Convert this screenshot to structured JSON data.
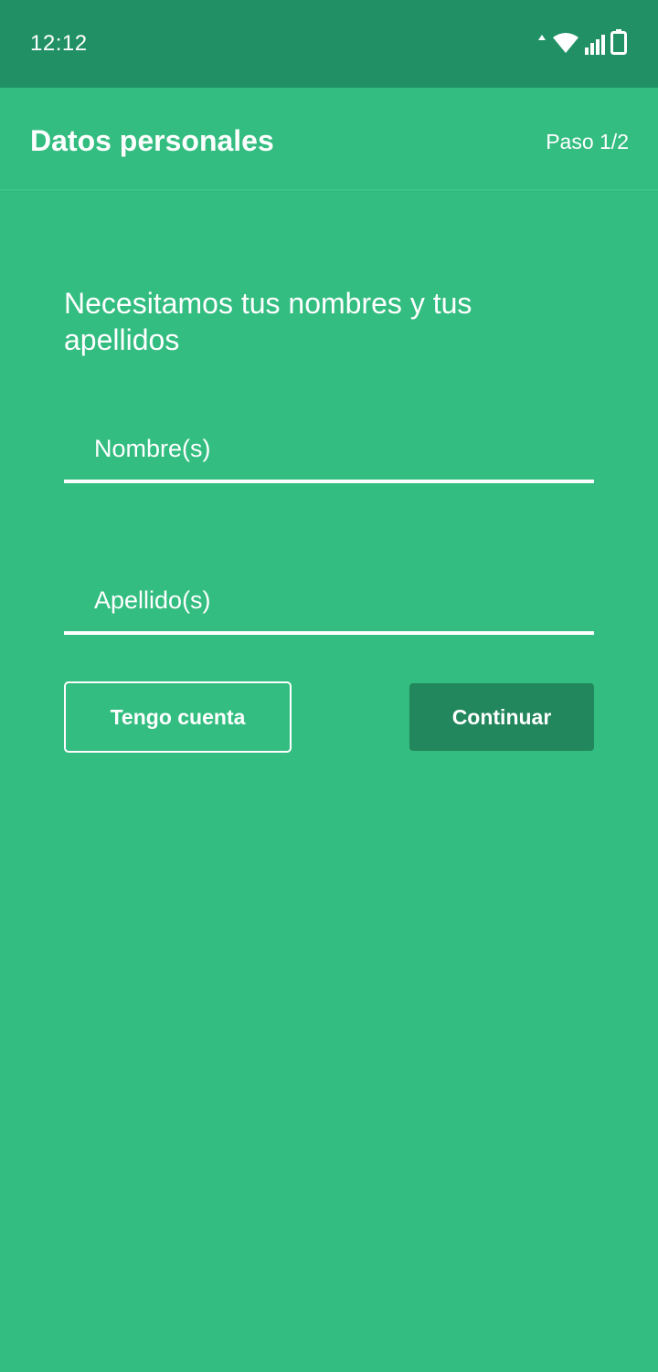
{
  "status_bar": {
    "time": "12:12",
    "icons": [
      "data-arrows-icon",
      "wifi-icon",
      "signal-icon",
      "battery-icon"
    ]
  },
  "app_bar": {
    "title": "Datos personales",
    "step": "Paso 1/2"
  },
  "form": {
    "question": "Necesitamos tus nombres y tus apellidos",
    "first_name": {
      "placeholder": "Nombre(s)",
      "value": ""
    },
    "last_name": {
      "placeholder": "Apellido(s)",
      "value": ""
    }
  },
  "actions": {
    "have_account_label": "Tengo cuenta",
    "continue_label": "Continuar"
  },
  "colors": {
    "background": "#33bd80",
    "status_bar": "#219065",
    "primary_button": "#22875c",
    "text": "#ffffff"
  }
}
